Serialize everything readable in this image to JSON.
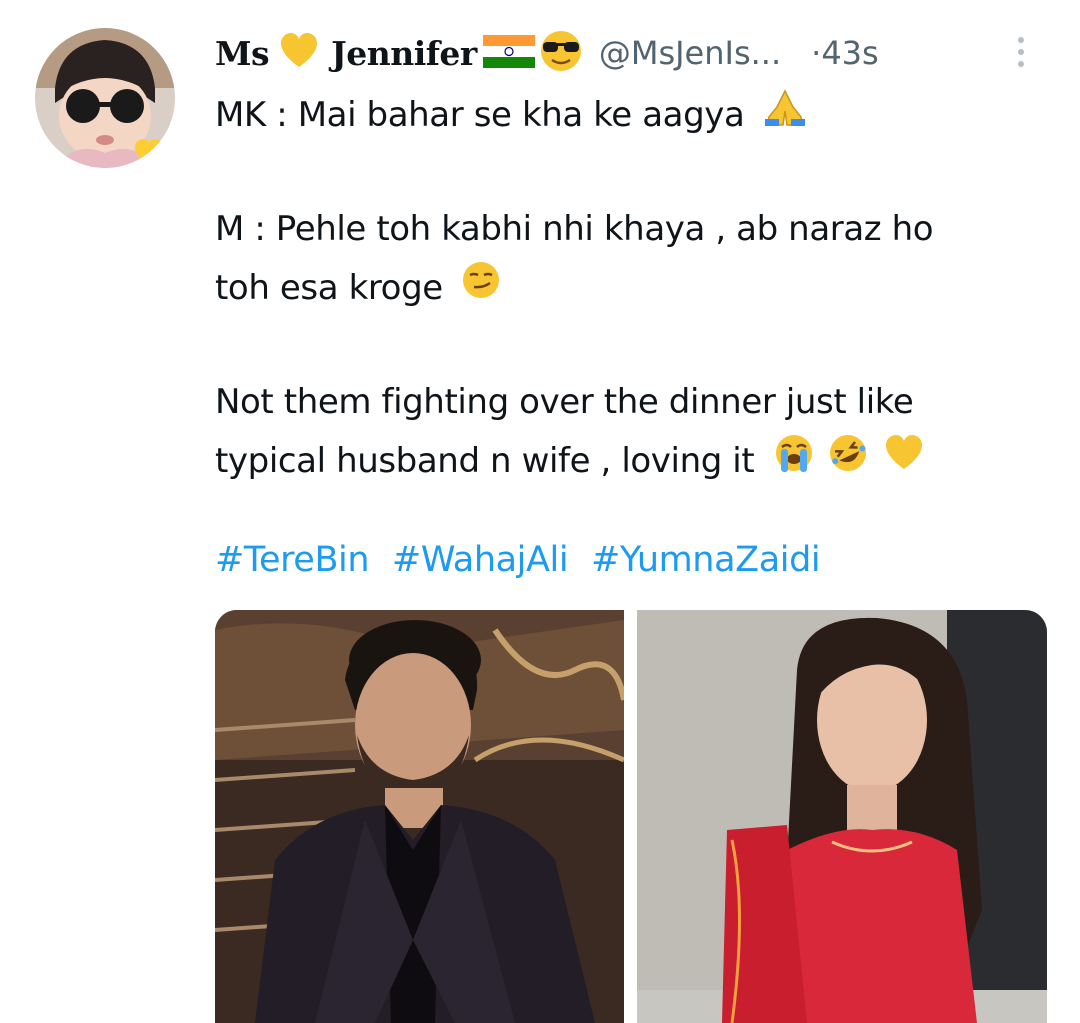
{
  "user": {
    "display_name_part1": "Ms",
    "display_name_part2": "Jennifer",
    "handle": "@MsJenIs...",
    "separator": "·",
    "time": "43s"
  },
  "tweet": {
    "line1": "MK : Mai bahar se kha ke aagya",
    "line2": "M : Pehle toh kabhi nhi khaya , ab naraz ho",
    "line3": "toh esa kroge",
    "line4": "Not them fighting over the dinner just like",
    "line5": "typical husband n wife , loving it",
    "hashtags": [
      "#TereBin",
      "#WahajAli",
      "#YumnaZaidi"
    ]
  },
  "icons": {
    "yellow_heart": "yellow-heart-icon",
    "india_flag": "india-flag-icon",
    "sunglasses": "sunglasses-face-icon",
    "pray": "folded-hands-icon",
    "smirk": "smirk-face-icon",
    "crying": "loudly-crying-face-icon",
    "rofl": "rolling-laughing-face-icon",
    "more": "more-vertical-icon"
  },
  "colors": {
    "link": "#1d9bf0",
    "secondary": "#536471",
    "text": "#0f1419"
  }
}
